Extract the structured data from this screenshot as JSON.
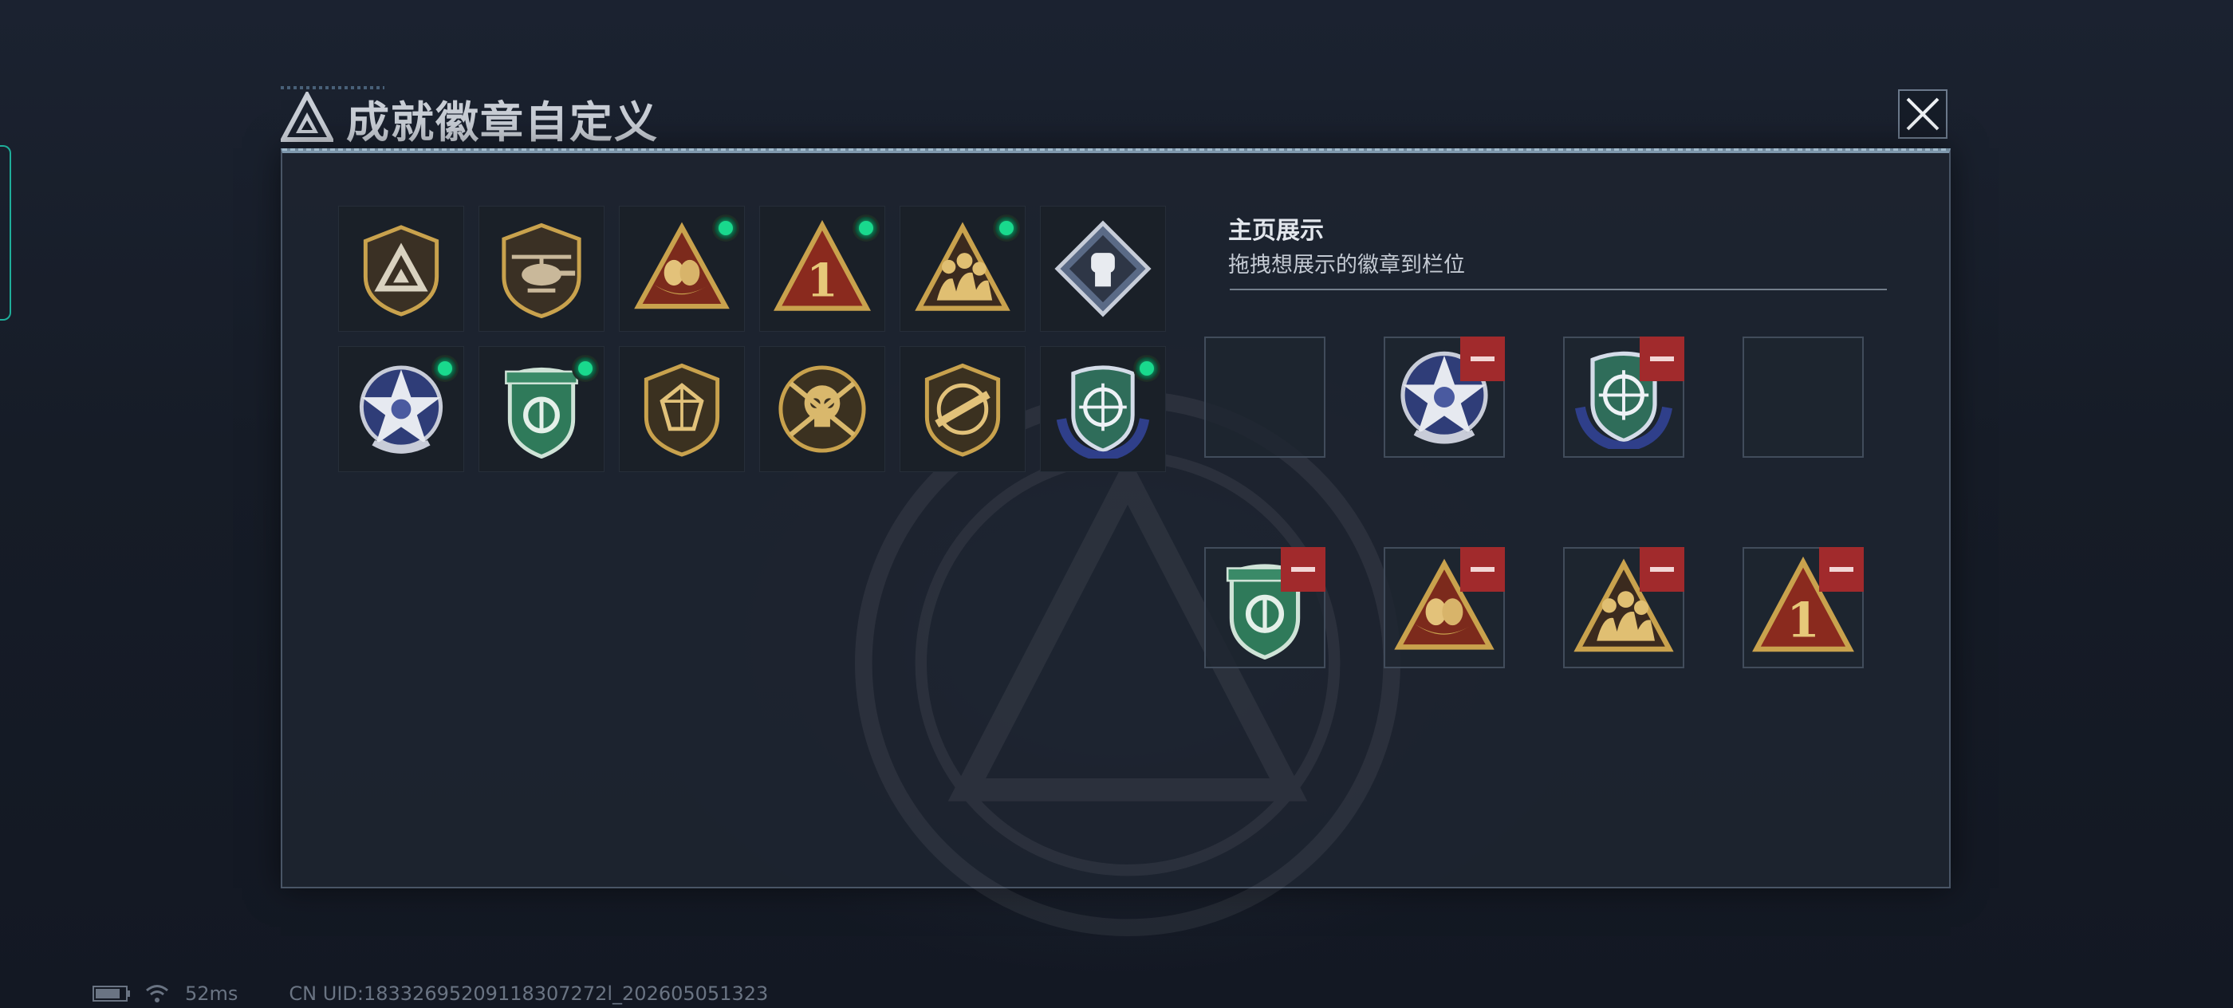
{
  "dialog": {
    "title": "成就徽章自定义",
    "close_icon": "close-icon"
  },
  "badges": [
    {
      "icon": "triangle-shield-badge",
      "equipped": false
    },
    {
      "icon": "helicopter-badge",
      "equipped": false
    },
    {
      "icon": "egg-nest-triangle-badge",
      "equipped": true
    },
    {
      "icon": "number-one-triangle-badge",
      "equipped": true
    },
    {
      "icon": "squad-triangle-badge",
      "equipped": true
    },
    {
      "icon": "fist-diamond-badge",
      "equipped": false
    },
    {
      "icon": "blue-star-badge",
      "equipped": true
    },
    {
      "icon": "green-shield-badge",
      "equipped": true
    },
    {
      "icon": "gem-shield-badge",
      "equipped": false
    },
    {
      "icon": "crossed-skull-badge",
      "equipped": false
    },
    {
      "icon": "rifle-shield-badge",
      "equipped": false
    },
    {
      "icon": "crosshair-wreath-badge",
      "equipped": true
    }
  ],
  "showcase": {
    "heading": "主页展示",
    "subtitle": "拖拽想展示的徽章到栏位",
    "slots": [
      {
        "icon": null
      },
      {
        "icon": "blue-star-badge"
      },
      {
        "icon": "crosshair-wreath-badge"
      },
      {
        "icon": null
      },
      {
        "icon": "green-shield-badge"
      },
      {
        "icon": "egg-nest-triangle-badge"
      },
      {
        "icon": "squad-triangle-badge"
      },
      {
        "icon": "number-one-triangle-badge"
      }
    ]
  },
  "status": {
    "ping": "52ms",
    "uid": "CN UID:18332695209118307272l_202605051323"
  },
  "colors": {
    "accent_teal": "#1fae9a",
    "equipped_green": "#19d98d",
    "remove_red": "#a12a2c",
    "gold": "#c9a24d"
  }
}
